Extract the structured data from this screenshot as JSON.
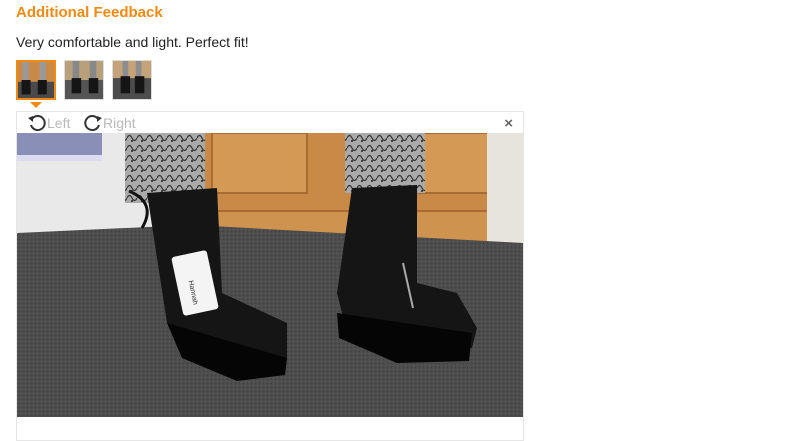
{
  "feedback": {
    "heading": "Additional Feedback",
    "text": "Very comfortable and light. Perfect fit!"
  },
  "thumbnails": [
    {
      "name": "photo-thumbnail-1",
      "selected": true
    },
    {
      "name": "photo-thumbnail-2",
      "selected": false
    },
    {
      "name": "photo-thumbnail-3",
      "selected": false
    }
  ],
  "viewer": {
    "rotate_left_label": "Left",
    "rotate_right_label": "Right",
    "close_glyph": "×",
    "tag_text": "Hannah"
  },
  "colors": {
    "accent": "#f08a13",
    "door": "#c98a47",
    "carpet": "#4a4a4a",
    "boot": "#151515"
  }
}
